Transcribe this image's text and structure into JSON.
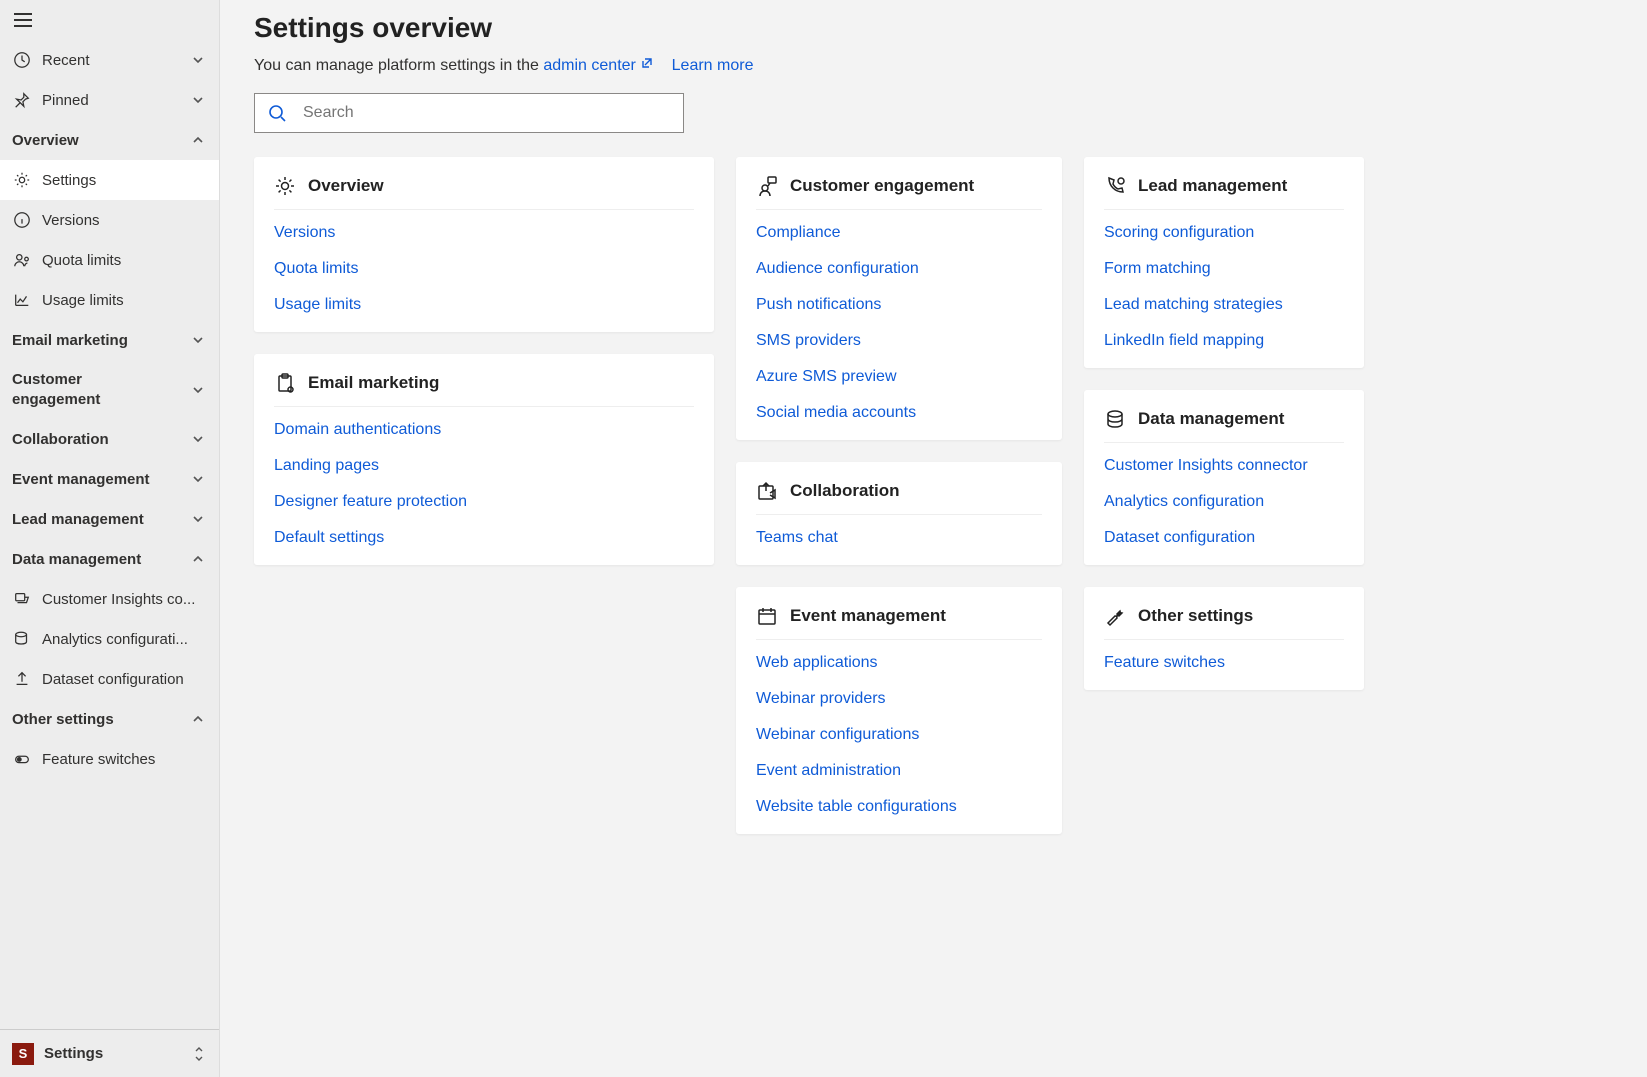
{
  "sidebar": {
    "recent": "Recent",
    "pinned": "Pinned",
    "sections": {
      "overview": {
        "label": "Overview",
        "items": [
          "Settings",
          "Versions",
          "Quota limits",
          "Usage limits"
        ]
      },
      "email_marketing": {
        "label": "Email marketing"
      },
      "customer_engagement": {
        "label": "Customer engagement"
      },
      "collaboration": {
        "label": "Collaboration"
      },
      "event_management": {
        "label": "Event management"
      },
      "lead_management": {
        "label": "Lead management"
      },
      "data_management": {
        "label": "Data management",
        "items": [
          "Customer Insights co...",
          "Analytics configurati...",
          "Dataset configuration"
        ]
      },
      "other_settings": {
        "label": "Other settings",
        "items": [
          "Feature switches"
        ]
      }
    },
    "area": {
      "badge": "S",
      "label": "Settings"
    }
  },
  "page": {
    "title": "Settings overview",
    "subtitle_prefix": "You can manage platform settings in the ",
    "admin_link": "admin center",
    "learn_more": "Learn more",
    "search_placeholder": "Search"
  },
  "cards": {
    "overview": {
      "title": "Overview",
      "links": [
        "Versions",
        "Quota limits",
        "Usage limits"
      ]
    },
    "email_marketing": {
      "title": "Email marketing",
      "links": [
        "Domain authentications",
        "Landing pages",
        "Designer feature protection",
        "Default settings"
      ]
    },
    "customer_engagement": {
      "title": "Customer engagement",
      "links": [
        "Compliance",
        "Audience configuration",
        "Push notifications",
        "SMS providers",
        "Azure SMS preview",
        "Social media accounts"
      ]
    },
    "collaboration": {
      "title": "Collaboration",
      "links": [
        "Teams chat"
      ]
    },
    "event_management": {
      "title": "Event management",
      "links": [
        "Web applications",
        "Webinar providers",
        "Webinar configurations",
        "Event administration",
        "Website table configurations"
      ]
    },
    "lead_management": {
      "title": "Lead management",
      "links": [
        "Scoring configuration",
        "Form matching",
        "Lead matching strategies",
        "LinkedIn field mapping"
      ]
    },
    "data_management": {
      "title": "Data management",
      "links": [
        "Customer Insights connector",
        "Analytics configuration",
        "Dataset configuration"
      ]
    },
    "other_settings": {
      "title": "Other settings",
      "links": [
        "Feature switches"
      ]
    }
  }
}
